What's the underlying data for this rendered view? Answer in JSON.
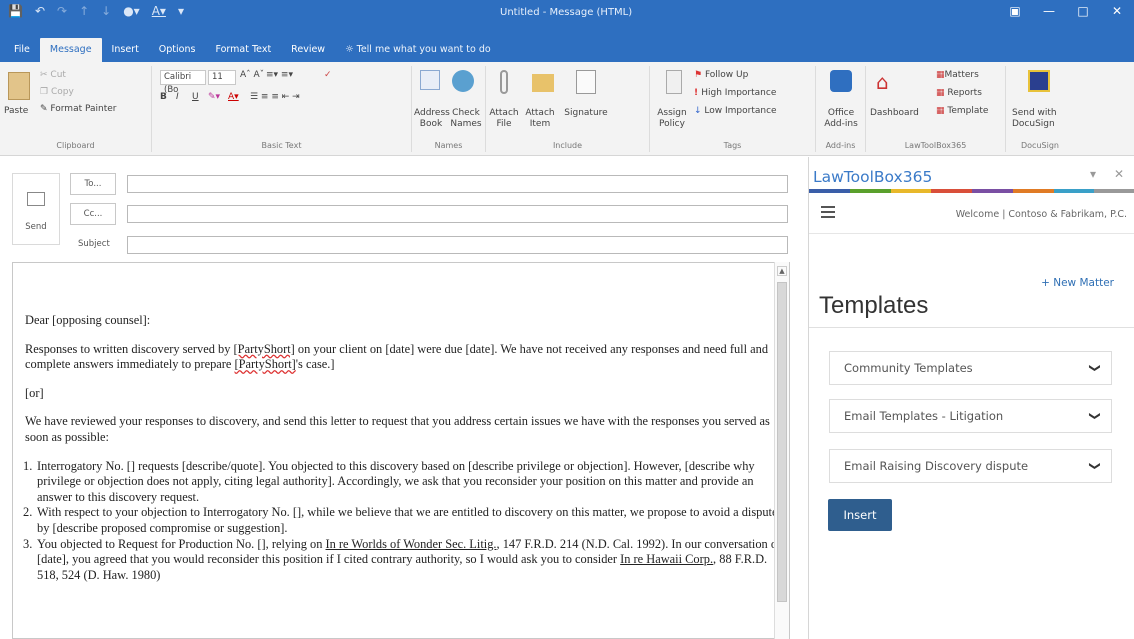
{
  "window": {
    "title": "Untitled - Message (HTML)",
    "qat_icons": [
      "save-icon",
      "undo-icon",
      "redo-icon",
      "up-arrow-icon",
      "down-arrow-icon",
      "account-icon",
      "font-color-icon",
      "customize-icon"
    ],
    "controls": [
      "ribbon-display-icon",
      "minimize-icon",
      "maximize-icon",
      "close-icon"
    ]
  },
  "tabs": [
    "File",
    "Message",
    "Insert",
    "Options",
    "Format Text",
    "Review"
  ],
  "active_tab": "Message",
  "tell_me": "Tell me what you want to do",
  "ribbon": {
    "clipboard": {
      "paste": "Paste",
      "cut": "Cut",
      "copy": "Copy",
      "format_painter": "Format Painter",
      "label": "Clipboard"
    },
    "basic_text": {
      "font": "Calibri (Bo",
      "size": "11",
      "label": "Basic Text",
      "bold": "B",
      "italic": "I",
      "underline": "U"
    },
    "names": {
      "address_book": "Address Book",
      "check_names": "Check Names",
      "label": "Names"
    },
    "include": {
      "attach_file": "Attach File",
      "attach_item": "Attach Item",
      "signature": "Signature",
      "label": "Include"
    },
    "assign_policy": "Assign Policy",
    "tags": {
      "follow_up": "Follow Up",
      "high": "High Importance",
      "low": "Low Importance",
      "label": "Tags"
    },
    "addins": {
      "office": "Office Add-ins",
      "label": "Add-ins"
    },
    "lawtoolbox": {
      "dashboard": "Dashboard",
      "matters": "Matters",
      "reports": "Reports",
      "template": "Template",
      "label": "LawToolBox365"
    },
    "docusign": {
      "send": "Send with DocuSign",
      "label": "DocuSign"
    }
  },
  "compose": {
    "send": "Send",
    "to": "To...",
    "cc": "Cc...",
    "subject": "Subject",
    "greeting": "Dear [opposing counsel]:",
    "p1_a": "Responses to written discovery served by ",
    "p1_party": "[PartyShort]",
    "p1_b": " on your client on [date] were due [date]. We have not received any responses and need full and complete answers immediately to prepare ",
    "p1_party2": "[PartyShort]",
    "p1_c": "'s case.]",
    "p2": "[or]",
    "p3": "We have reviewed your responses to discovery, and send this letter to request that you address certain issues we have with the responses you served as soon as possible:",
    "li1_num": "1.",
    "li1": "Interrogatory No. [] requests [describe/quote]. You objected to this discovery based on [describe privilege or objection]. However, [describe why privilege or objection does not apply, citing legal authority]. Accordingly, we ask that you reconsider your position on this matter and provide an answer to this discovery request.",
    "li2_num": "2.",
    "li2": "With respect to your objection to Interrogatory No. [], while we believe that we are entitled to discovery on this matter, we propose to avoid a dispute by [describe proposed compromise or suggestion].",
    "li3_num": "3.",
    "li3_a": "You objected to Request for Production No. [], relying on ",
    "li3_case1": "In re Worlds of Wonder Sec. Litig.",
    "li3_b": ", 147 F.R.D. 214 (N.D. Cal. 1992). In our conversation of [date], you agreed that you would reconsider this position if I cited contrary authority, so I would ask you to consider ",
    "li3_case2": "In re Hawaii Corp.",
    "li3_c": ", 88 F.R.D. 518, 524 (D. Haw. 1980)"
  },
  "pane": {
    "title": "LawToolBox365",
    "welcome": "Welcome | Contoso & Fabrikam, P.C.",
    "new_matter": "+ New Matter",
    "heading": "Templates",
    "dropdowns": [
      "Community Templates",
      "Email Templates - Litigation",
      "Email Raising Discovery dispute"
    ],
    "insert": "Insert",
    "colors": [
      "#3a5ea8",
      "#5aa02c",
      "#e8b82a",
      "#d94f3a",
      "#7a4fa3",
      "#e07b25",
      "#3aa0c8",
      "#999999"
    ]
  }
}
